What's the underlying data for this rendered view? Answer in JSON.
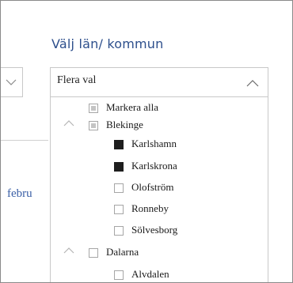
{
  "left": {
    "month_label": "febru"
  },
  "slicer": {
    "title": "Välj län/ kommun",
    "dropdown_value": "Flera val",
    "items": [
      {
        "label": "Markera alla",
        "state": "partial",
        "level": 0,
        "expander": false
      },
      {
        "label": "Blekinge",
        "state": "partial",
        "level": 0,
        "expander": true
      },
      {
        "label": "Karlshamn",
        "state": "checked",
        "level": 1,
        "expander": false
      },
      {
        "label": "Karlskrona",
        "state": "checked",
        "level": 1,
        "expander": false
      },
      {
        "label": "Olofström",
        "state": "unchecked",
        "level": 1,
        "expander": false
      },
      {
        "label": "Ronneby",
        "state": "unchecked",
        "level": 1,
        "expander": false
      },
      {
        "label": "Sölvesborg",
        "state": "unchecked",
        "level": 1,
        "expander": false
      },
      {
        "label": "Dalarna",
        "state": "unchecked",
        "level": 0,
        "expander": true
      },
      {
        "label": "Alvdalen",
        "state": "unchecked",
        "level": 1,
        "expander": false
      }
    ]
  },
  "colors": {
    "title": "#2d4f8c",
    "link_text": "#3a5fa6",
    "checked_fill": "#1e1e1e",
    "border": "#c8c8c8"
  }
}
